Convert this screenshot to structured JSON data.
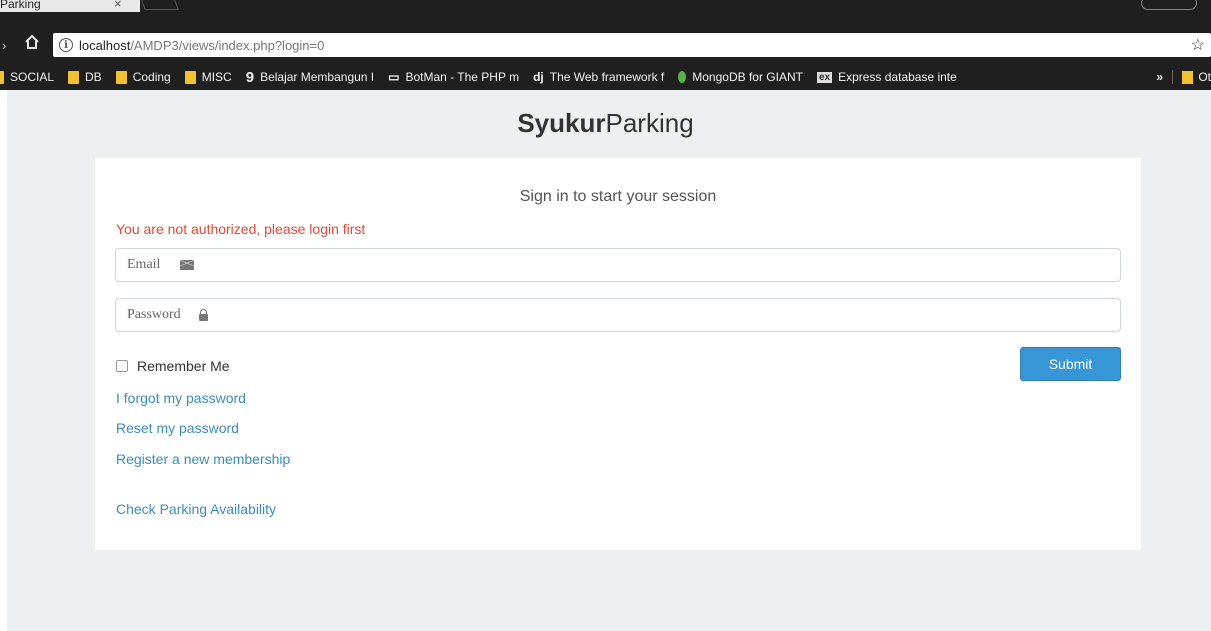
{
  "browser": {
    "tab_title": "Parking",
    "tab_close": "×",
    "url_host": "localhost",
    "url_path": "/AMDP3/views/index.php?login=0",
    "bookmarks": [
      {
        "icon": "folder-icon",
        "label": "SOCIAL"
      },
      {
        "icon": "folder-icon",
        "label": "DB"
      },
      {
        "icon": "folder-icon",
        "label": "Coding"
      },
      {
        "icon": "folder-icon",
        "label": "MISC"
      },
      {
        "icon": "g-icon",
        "glyph": "9",
        "label": "Belajar Membangun I"
      },
      {
        "icon": "botman-icon",
        "glyph": "▭",
        "label": "BotMan - The PHP m"
      },
      {
        "icon": "django-icon",
        "glyph": "dj",
        "label": "The Web framework f"
      },
      {
        "icon": "mongodb-icon",
        "label": "MongoDB for GIANT"
      },
      {
        "icon": "express-icon",
        "glyph": "ex",
        "label": "Express database inte"
      }
    ],
    "bookmarks_more": "»",
    "bookmarks_other": "Ot"
  },
  "page": {
    "brand_bold": "Syukur",
    "brand_rest": "Parking",
    "box_message": "Sign in to start your session",
    "error_message": "You are not authorized, please login first",
    "email_placeholder": "Email",
    "password_placeholder": "Password",
    "remember_label": "Remember Me",
    "submit_label": "Submit",
    "forgot_link": "I forgot my password",
    "reset_link": "Reset my password",
    "register_link": "Register a new membership",
    "availability_link": "Check Parking Availability"
  },
  "colors": {
    "page_bg": "#ecf0f1",
    "error": "#dd4b39",
    "link": "#3c8dbc",
    "button": "#3796d6"
  }
}
